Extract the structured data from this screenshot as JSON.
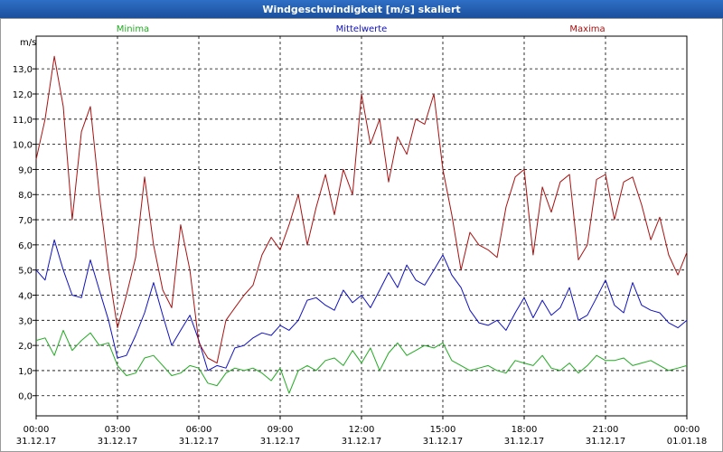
{
  "window": {
    "title": "Windgeschwindigkeit [m/s] skaliert"
  },
  "colors": {
    "minima": "#22aa22",
    "mittelwerte": "#1010c0",
    "maxima": "#aa1010",
    "grid": "#000000"
  },
  "chart_data": {
    "type": "line",
    "title": "Windgeschwindigkeit [m/s] skaliert",
    "ylabel": "m/s",
    "xlabel": "",
    "ylim": [
      -0.8,
      14.3
    ],
    "yticks": [
      "0,0",
      "1,0",
      "2,0",
      "3,0",
      "4,0",
      "5,0",
      "6,0",
      "7,0",
      "8,0",
      "9,0",
      "10,0",
      "11,0",
      "12,0",
      "13,0"
    ],
    "xlim": [
      0,
      24
    ],
    "xticks": [
      {
        "time": "00:00",
        "date": "31.12.17"
      },
      {
        "time": "03:00",
        "date": "31.12.17"
      },
      {
        "time": "06:00",
        "date": "31.12.17"
      },
      {
        "time": "09:00",
        "date": "31.12.17"
      },
      {
        "time": "12:00",
        "date": "31.12.17"
      },
      {
        "time": "15:00",
        "date": "31.12.17"
      },
      {
        "time": "18:00",
        "date": "31.12.17"
      },
      {
        "time": "21:00",
        "date": "31.12.17"
      },
      {
        "time": "00:00",
        "date": "01.01.18"
      }
    ],
    "grid": true,
    "legend_position": "top",
    "series": [
      {
        "name": "Minima",
        "x": [
          0,
          0.33,
          0.67,
          1,
          1.33,
          1.67,
          2,
          2.33,
          2.67,
          3,
          3.33,
          3.67,
          4,
          4.33,
          4.67,
          5,
          5.33,
          5.67,
          6,
          6.33,
          6.67,
          7,
          7.33,
          7.67,
          8,
          8.33,
          8.67,
          9,
          9.33,
          9.67,
          10,
          10.33,
          10.67,
          11,
          11.33,
          11.67,
          12,
          12.33,
          12.67,
          13,
          13.33,
          13.67,
          14,
          14.33,
          14.67,
          15,
          15.33,
          15.67,
          16,
          16.33,
          16.67,
          17,
          17.33,
          17.67,
          18,
          18.33,
          18.67,
          19,
          19.33,
          19.67,
          20,
          20.33,
          20.67,
          21,
          21.33,
          21.67,
          22,
          22.33,
          22.67,
          23,
          23.33,
          23.67,
          24
        ],
        "values": [
          2.2,
          2.3,
          1.6,
          2.6,
          1.8,
          2.2,
          2.5,
          2.0,
          2.1,
          1.2,
          0.8,
          0.9,
          1.5,
          1.6,
          1.2,
          0.8,
          0.9,
          1.2,
          1.1,
          0.5,
          0.4,
          0.9,
          1.1,
          1.0,
          1.1,
          0.9,
          0.6,
          1.1,
          0.1,
          1.0,
          1.2,
          1.0,
          1.4,
          1.5,
          1.2,
          1.8,
          1.3,
          1.9,
          1.0,
          1.7,
          2.1,
          1.6,
          1.8,
          2.0,
          1.9,
          2.1,
          1.4,
          1.2,
          1.0,
          1.1,
          1.2,
          1.0,
          0.9,
          1.4,
          1.3,
          1.2,
          1.6,
          1.1,
          1.0,
          1.3,
          0.9,
          1.2,
          1.6,
          1.4,
          1.4,
          1.5,
          1.2,
          1.3,
          1.4,
          1.2,
          1.0,
          1.1,
          1.2
        ]
      },
      {
        "name": "Mittelwerte",
        "x": [
          0,
          0.33,
          0.67,
          1,
          1.33,
          1.67,
          2,
          2.33,
          2.67,
          3,
          3.33,
          3.67,
          4,
          4.33,
          4.67,
          5,
          5.33,
          5.67,
          6,
          6.33,
          6.67,
          7,
          7.33,
          7.67,
          8,
          8.33,
          8.67,
          9,
          9.33,
          9.67,
          10,
          10.33,
          10.67,
          11,
          11.33,
          11.67,
          12,
          12.33,
          12.67,
          13,
          13.33,
          13.67,
          14,
          14.33,
          14.67,
          15,
          15.33,
          15.67,
          16,
          16.33,
          16.67,
          17,
          17.33,
          17.67,
          18,
          18.33,
          18.67,
          19,
          19.33,
          19.67,
          20,
          20.33,
          20.67,
          21,
          21.33,
          21.67,
          22,
          22.33,
          22.67,
          23,
          23.33,
          23.67,
          24
        ],
        "values": [
          5.0,
          4.6,
          6.2,
          5.0,
          4.0,
          3.9,
          5.4,
          4.2,
          3.0,
          1.5,
          1.6,
          2.4,
          3.3,
          4.5,
          3.2,
          2.0,
          2.6,
          3.2,
          2.2,
          1.0,
          1.2,
          1.1,
          1.9,
          2.0,
          2.3,
          2.5,
          2.4,
          2.8,
          2.6,
          3.0,
          3.8,
          3.9,
          3.6,
          3.4,
          4.2,
          3.7,
          4.0,
          3.5,
          4.2,
          4.9,
          4.3,
          5.2,
          4.6,
          4.4,
          5.0,
          5.6,
          4.8,
          4.3,
          3.4,
          2.9,
          2.8,
          3.0,
          2.6,
          3.3,
          3.9,
          3.1,
          3.8,
          3.2,
          3.5,
          4.3,
          3.0,
          3.2,
          3.9,
          4.6,
          3.6,
          3.3,
          4.5,
          3.6,
          3.4,
          3.3,
          2.9,
          2.7,
          3.0
        ]
      },
      {
        "name": "Maxima",
        "x": [
          0,
          0.33,
          0.67,
          1,
          1.33,
          1.67,
          2,
          2.33,
          2.67,
          3,
          3.33,
          3.67,
          4,
          4.33,
          4.67,
          5,
          5.33,
          5.67,
          6,
          6.33,
          6.67,
          7,
          7.33,
          7.67,
          8,
          8.33,
          8.67,
          9,
          9.33,
          9.67,
          10,
          10.33,
          10.67,
          11,
          11.33,
          11.67,
          12,
          12.33,
          12.67,
          13,
          13.33,
          13.67,
          14,
          14.33,
          14.67,
          15,
          15.33,
          15.67,
          16,
          16.33,
          16.67,
          17,
          17.33,
          17.67,
          18,
          18.33,
          18.67,
          19,
          19.33,
          19.67,
          20,
          20.33,
          20.67,
          21,
          21.33,
          21.67,
          22,
          22.33,
          22.67,
          23,
          23.33,
          23.67,
          24
        ],
        "values": [
          9.4,
          11.0,
          13.5,
          11.5,
          7.0,
          10.5,
          11.5,
          8.0,
          5.0,
          2.7,
          4.0,
          5.5,
          8.7,
          6.0,
          4.2,
          3.5,
          6.8,
          5.0,
          2.1,
          1.5,
          1.3,
          3.0,
          3.5,
          4.0,
          4.4,
          5.6,
          6.3,
          5.8,
          6.8,
          8.0,
          6.0,
          7.5,
          8.8,
          7.2,
          9.0,
          8.0,
          12.0,
          10.0,
          11.0,
          8.5,
          10.3,
          9.6,
          11.0,
          10.8,
          12.0,
          9.0,
          7.2,
          5.0,
          6.5,
          6.0,
          5.8,
          5.5,
          7.5,
          8.7,
          9.0,
          5.6,
          8.3,
          7.3,
          8.5,
          8.8,
          5.4,
          6.0,
          8.6,
          8.8,
          7.0,
          8.5,
          8.7,
          7.6,
          6.2,
          7.1,
          5.6,
          4.8,
          5.7
        ]
      }
    ]
  }
}
